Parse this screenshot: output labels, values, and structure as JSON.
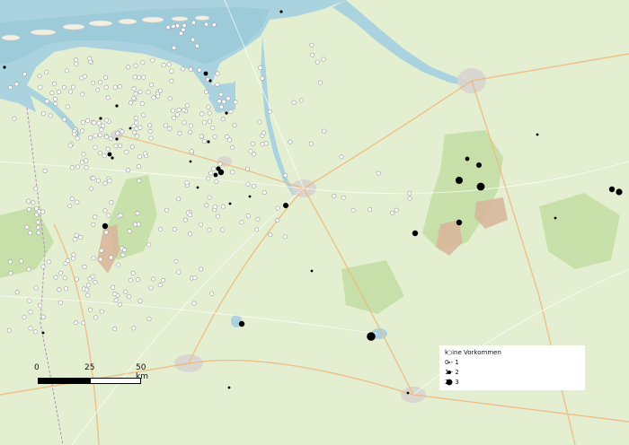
{
  "legend": {
    "title": "keine Vorkommen",
    "classes": [
      {
        "label": "0 - 1"
      },
      {
        "label": "1 - 2"
      },
      {
        "label": "2 - 3"
      }
    ]
  },
  "scalebar": {
    "labels": [
      "0",
      "25",
      "50 km"
    ]
  },
  "colors": {
    "sea": "#aad3df",
    "land": "#e4efd2",
    "forest": "#c4dfa6",
    "heath": "#d9b49a",
    "water": "#aad3df",
    "urban": "#d8d4d0",
    "marker_present": "#000000",
    "marker_absent": "#ffffff"
  }
}
